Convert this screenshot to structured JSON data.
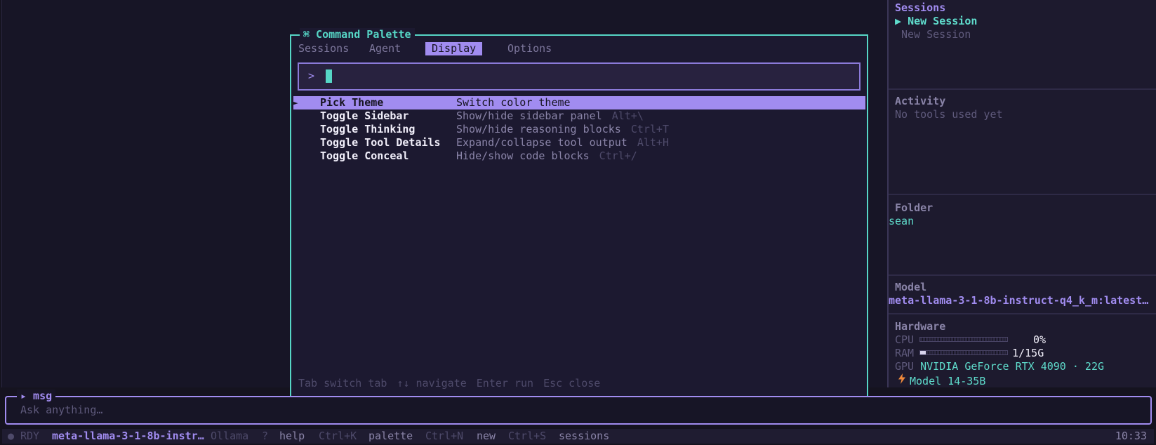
{
  "palette": {
    "title": "⌘ Command Palette",
    "tabs": [
      "Sessions",
      "Agent",
      "Display",
      "Options"
    ],
    "active_tab": "Display",
    "prompt": ">",
    "search_value": "",
    "selected_marker": "►",
    "items": [
      {
        "name": "Pick Theme",
        "desc": "Switch color theme",
        "key": ""
      },
      {
        "name": "Toggle Sidebar",
        "desc": "Show/hide sidebar panel",
        "key": "Alt+\\"
      },
      {
        "name": "Toggle Thinking",
        "desc": "Show/hide reasoning blocks",
        "key": "Ctrl+T"
      },
      {
        "name": "Toggle Tool Details",
        "desc": "Expand/collapse tool output",
        "key": "Alt+H"
      },
      {
        "name": "Toggle Conceal",
        "desc": "Hide/show code blocks",
        "key": "Ctrl+/"
      }
    ],
    "hints": [
      "Tab switch tab",
      "↑↓ navigate",
      "Enter run",
      "Esc close"
    ]
  },
  "sidebar": {
    "sessions_title": "Sessions",
    "sessions": [
      {
        "marker": "▶",
        "label": "New Session",
        "active": true
      },
      {
        "marker": "",
        "label": "New Session",
        "active": false
      }
    ],
    "activity_title": "Activity",
    "activity_text": "No tools used yet",
    "folder_title": "Folder",
    "folder_value": "sean",
    "model_title": "Model",
    "model_value": "meta-llama-3-1-8b-instruct-q4_k_m:latest…",
    "hardware_title": "Hardware",
    "cpu_label": "CPU",
    "cpu_value": "0%",
    "cpu_fraction": 0.0,
    "ram_label": "RAM",
    "ram_value": "1/15G",
    "ram_fraction": 0.067,
    "gpu_label": "GPU",
    "gpu_value": "NVIDIA GeForce RTX 4090 · 22G",
    "model_size_icon": "lightning-icon",
    "model_size": "Model 14-35B"
  },
  "message": {
    "title": "▸ msg",
    "placeholder": "Ask anything…"
  },
  "status": {
    "indicator": "●",
    "state": "RDY",
    "model": "meta-llama-3-1-8b-instr…",
    "provider": "Ollama",
    "shortcuts": [
      {
        "key": "?",
        "label": "help"
      },
      {
        "key": "Ctrl+K",
        "label": "palette"
      },
      {
        "key": "Ctrl+N",
        "label": "new"
      },
      {
        "key": "Ctrl+S",
        "label": "sessions"
      }
    ],
    "time": "10:33"
  },
  "colors": {
    "accent": "#a18cf0",
    "teal": "#56d6c6",
    "background": "#15131f",
    "lightning": "#f08a3c"
  }
}
